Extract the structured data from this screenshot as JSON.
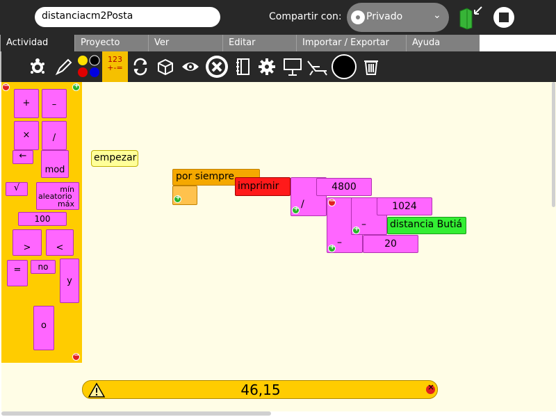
{
  "topbar": {
    "activity_title": "distanciacm2Posta",
    "share_label": "Compartir con:",
    "share_value": "Privado"
  },
  "tabs": [
    {
      "label": "Actividad",
      "active": true
    },
    {
      "label": "Proyecto",
      "active": false
    },
    {
      "label": "Ver",
      "active": false
    },
    {
      "label": "Editar",
      "active": false
    },
    {
      "label": "Importar / Exportar",
      "active": false
    },
    {
      "label": "Ayuda",
      "active": false
    }
  ],
  "toolbar": {
    "active_palette_line1": "123",
    "active_palette_line2": "+-=",
    "icons": [
      "turtle-icon",
      "pen-icon",
      "colors-icon",
      "numbers-icon",
      "flow-icon",
      "blocks-icon",
      "sensors-icon",
      "stop-turtle-icon",
      "notebook-icon",
      "settings-icon",
      "presentation-icon",
      "deck-chair-icon",
      "black-circle-icon",
      "trash-icon"
    ]
  },
  "palette": {
    "plus": "+",
    "minus": "–",
    "times": "×",
    "divide": "/",
    "identity": "←",
    "mod": "mod",
    "sqrt": "√",
    "random": "aleatorio",
    "random_min": "mín",
    "random_max": "máx",
    "number": "100",
    "greater": ">",
    "less": "<",
    "equal": "=",
    "not": "no",
    "and": "y",
    "or": "o"
  },
  "canvas": {
    "start": "empezar",
    "forever": "por siempre",
    "print": "imprimir",
    "div_op": "/",
    "minus_op1": "–",
    "minus_op2": "–",
    "num1": "4800",
    "num2": "1024",
    "num3": "20",
    "sensor": "distancia Butiá"
  },
  "status": {
    "value": "46,15"
  },
  "colors": {
    "topbar": "#282828",
    "palette": "#ffcc00",
    "canvas": "#fffde6",
    "number_block": "#ff66ff",
    "print_block": "#ff0000",
    "flow_block": "#f5a800",
    "sensor_block": "#33ee33"
  }
}
